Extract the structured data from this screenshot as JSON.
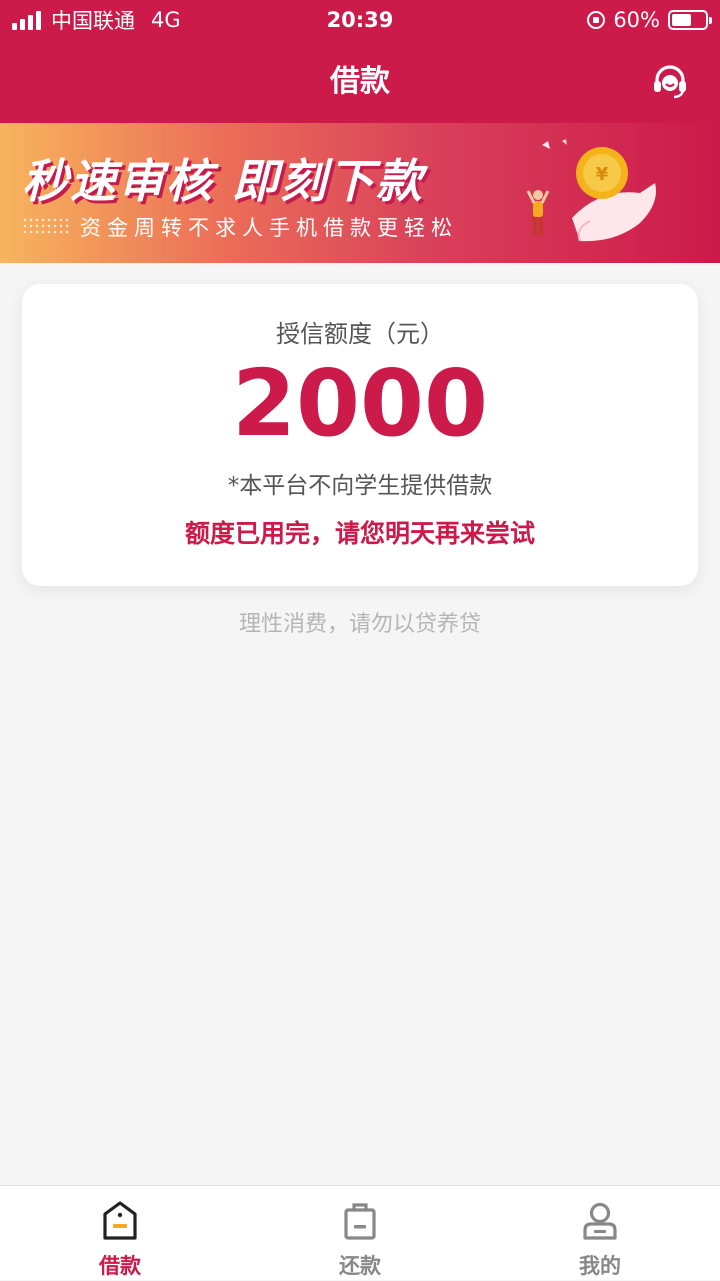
{
  "status_bar": {
    "carrier": "中国联通",
    "network": "4G",
    "time": "20:39",
    "battery": "60%",
    "battery_level": 0.6
  },
  "nav": {
    "title": "借款",
    "service_icon": "headset-icon"
  },
  "banner": {
    "title": "秒速审核  即刻下款",
    "subtitle": "资金周转不求人手机借款更轻松"
  },
  "credit_card": {
    "label": "授信额度（元）",
    "amount": "2000",
    "notice": "*本平台不向学生提供借款",
    "warning": "额度已用完，请您明天再来尝试"
  },
  "footer_tip": "理性消费，请勿以贷养贷",
  "tabs": [
    {
      "label": "借款",
      "icon": "borrow-icon",
      "active": true
    },
    {
      "label": "还款",
      "icon": "repay-icon",
      "active": false
    },
    {
      "label": "我的",
      "icon": "profile-icon",
      "active": false
    }
  ],
  "colors": {
    "brand": "#cc1a4a",
    "background": "#f5f5f5",
    "muted_text": "#b5b5b5"
  }
}
